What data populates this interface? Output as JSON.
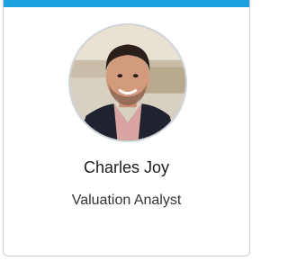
{
  "profile": {
    "name": "Charles Joy",
    "title": "Valuation Analyst"
  },
  "colors": {
    "accent": "#1aa0dc",
    "border": "#c9ced3"
  },
  "icons": {
    "avatar": "person-photo"
  }
}
